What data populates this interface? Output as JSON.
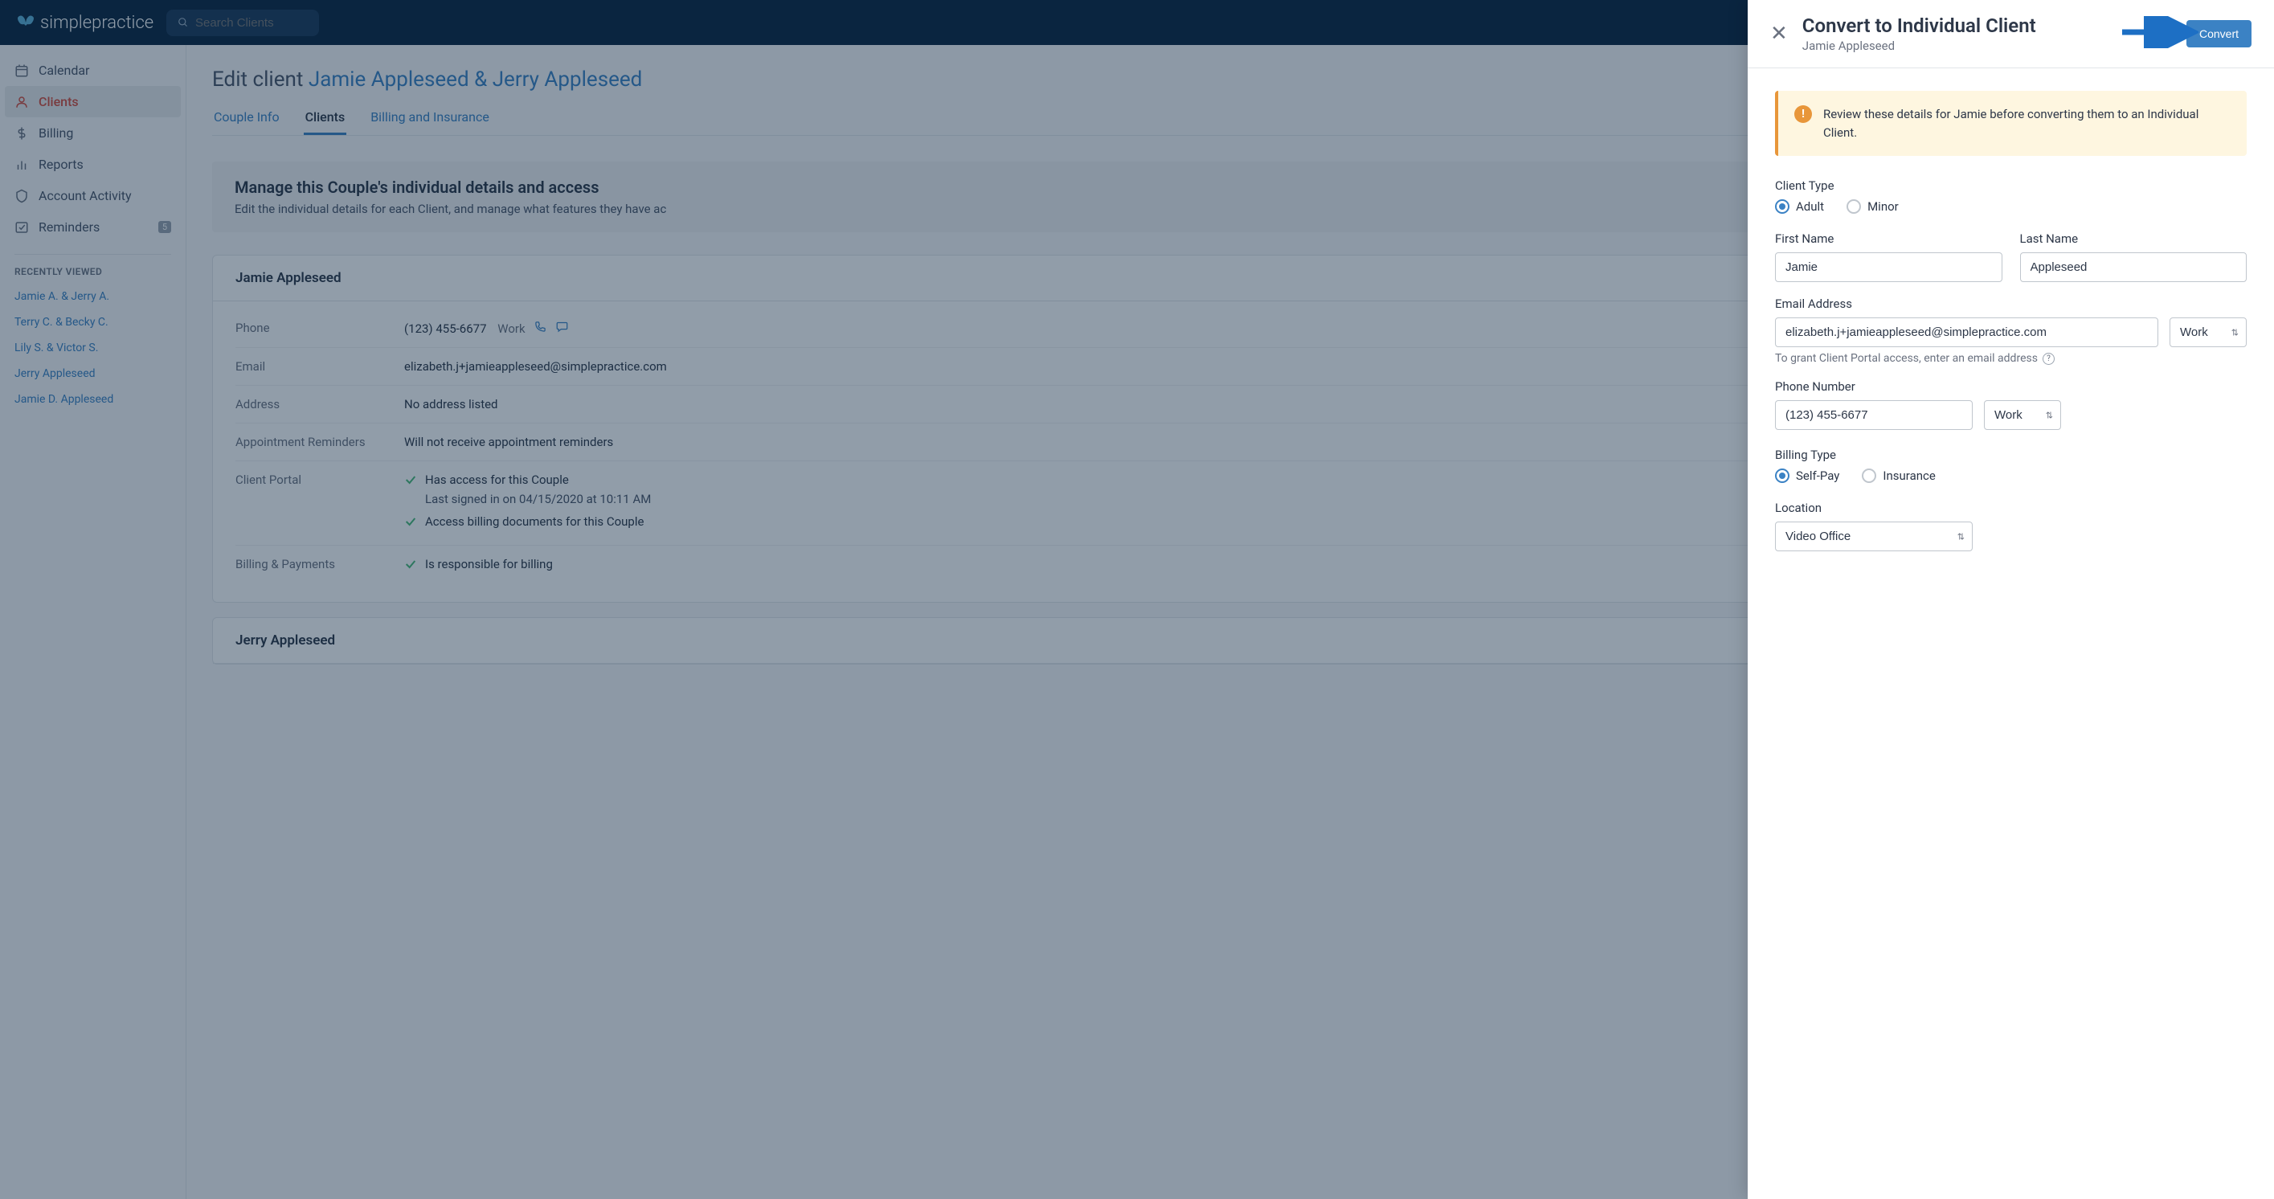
{
  "topbar": {
    "brand": "simplepractice",
    "search_placeholder": "Search Clients"
  },
  "sidebar": {
    "items": [
      {
        "label": "Calendar"
      },
      {
        "label": "Clients"
      },
      {
        "label": "Billing"
      },
      {
        "label": "Reports"
      },
      {
        "label": "Account Activity"
      },
      {
        "label": "Reminders",
        "badge": "5"
      }
    ],
    "recent_header": "RECENTLY VIEWED",
    "recent": [
      "Jamie A. & Jerry A.",
      "Terry C. & Becky C.",
      "Lily S. & Victor S.",
      "Jerry Appleseed",
      "Jamie D. Appleseed"
    ]
  },
  "main": {
    "edit_prefix": "Edit client ",
    "client_link": "Jamie Appleseed & Jerry Appleseed",
    "tabs": [
      "Couple Info",
      "Clients",
      "Billing and Insurance"
    ],
    "manage_title": "Manage this Couple's individual details and access",
    "manage_sub": "Edit the individual details for each Client, and manage what features they have ac",
    "card1": {
      "name": "Jamie Appleseed",
      "phone_label": "Phone",
      "phone": "(123) 455-6677",
      "phone_type": "Work",
      "email_label": "Email",
      "email": "elizabeth.j+jamieappleseed@simplepractice.com",
      "address_label": "Address",
      "address": "No address listed",
      "reminders_label": "Appointment Reminders",
      "reminders": "Will not receive appointment reminders",
      "portal_label": "Client Portal",
      "portal_line1": "Has access for this Couple",
      "portal_line2": "Last signed in on 04/15/2020 at 10:11 AM",
      "portal_line3": "Access billing documents for this Couple",
      "billing_label": "Billing & Payments",
      "billing_line": "Is responsible for billing"
    },
    "card2": {
      "name": "Jerry Appleseed"
    }
  },
  "panel": {
    "title": "Convert to Individual Client",
    "subtitle": "Jamie Appleseed",
    "convert_label": "Convert",
    "alert": "Review these details for Jamie before converting them to an Individual Client.",
    "client_type_label": "Client Type",
    "client_type_options": [
      "Adult",
      "Minor"
    ],
    "first_name_label": "First Name",
    "first_name": "Jamie",
    "last_name_label": "Last Name",
    "last_name": "Appleseed",
    "email_label": "Email Address",
    "email": "elizabeth.j+jamieappleseed@simplepractice.com",
    "email_type": "Work",
    "email_helper": "To grant Client Portal access, enter an email address",
    "phone_label": "Phone Number",
    "phone": "(123) 455-6677",
    "phone_type": "Work",
    "billing_type_label": "Billing Type",
    "billing_options": [
      "Self-Pay",
      "Insurance"
    ],
    "location_label": "Location",
    "location": "Video Office"
  }
}
